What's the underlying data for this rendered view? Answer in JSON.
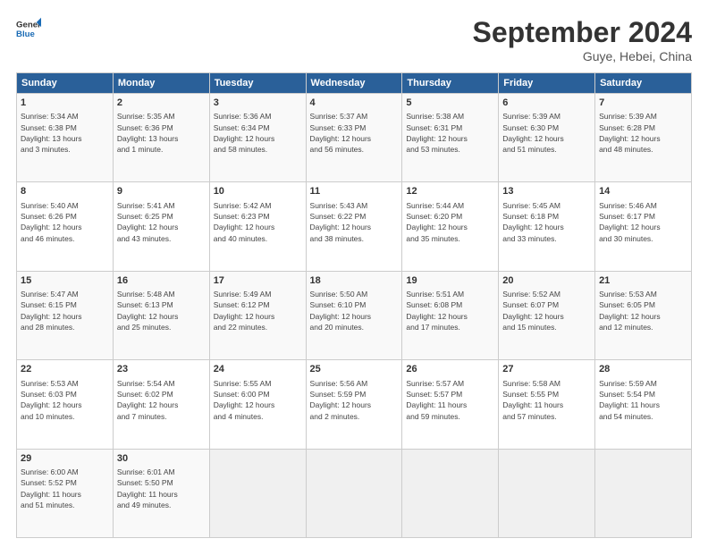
{
  "logo": {
    "line1": "General",
    "line2": "Blue"
  },
  "title": "September 2024",
  "subtitle": "Guye, Hebei, China",
  "headers": [
    "Sunday",
    "Monday",
    "Tuesday",
    "Wednesday",
    "Thursday",
    "Friday",
    "Saturday"
  ],
  "weeks": [
    [
      {
        "day": "1",
        "detail": "Sunrise: 5:34 AM\nSunset: 6:38 PM\nDaylight: 13 hours\nand 3 minutes."
      },
      {
        "day": "2",
        "detail": "Sunrise: 5:35 AM\nSunset: 6:36 PM\nDaylight: 13 hours\nand 1 minute."
      },
      {
        "day": "3",
        "detail": "Sunrise: 5:36 AM\nSunset: 6:34 PM\nDaylight: 12 hours\nand 58 minutes."
      },
      {
        "day": "4",
        "detail": "Sunrise: 5:37 AM\nSunset: 6:33 PM\nDaylight: 12 hours\nand 56 minutes."
      },
      {
        "day": "5",
        "detail": "Sunrise: 5:38 AM\nSunset: 6:31 PM\nDaylight: 12 hours\nand 53 minutes."
      },
      {
        "day": "6",
        "detail": "Sunrise: 5:39 AM\nSunset: 6:30 PM\nDaylight: 12 hours\nand 51 minutes."
      },
      {
        "day": "7",
        "detail": "Sunrise: 5:39 AM\nSunset: 6:28 PM\nDaylight: 12 hours\nand 48 minutes."
      }
    ],
    [
      {
        "day": "8",
        "detail": "Sunrise: 5:40 AM\nSunset: 6:26 PM\nDaylight: 12 hours\nand 46 minutes."
      },
      {
        "day": "9",
        "detail": "Sunrise: 5:41 AM\nSunset: 6:25 PM\nDaylight: 12 hours\nand 43 minutes."
      },
      {
        "day": "10",
        "detail": "Sunrise: 5:42 AM\nSunset: 6:23 PM\nDaylight: 12 hours\nand 40 minutes."
      },
      {
        "day": "11",
        "detail": "Sunrise: 5:43 AM\nSunset: 6:22 PM\nDaylight: 12 hours\nand 38 minutes."
      },
      {
        "day": "12",
        "detail": "Sunrise: 5:44 AM\nSunset: 6:20 PM\nDaylight: 12 hours\nand 35 minutes."
      },
      {
        "day": "13",
        "detail": "Sunrise: 5:45 AM\nSunset: 6:18 PM\nDaylight: 12 hours\nand 33 minutes."
      },
      {
        "day": "14",
        "detail": "Sunrise: 5:46 AM\nSunset: 6:17 PM\nDaylight: 12 hours\nand 30 minutes."
      }
    ],
    [
      {
        "day": "15",
        "detail": "Sunrise: 5:47 AM\nSunset: 6:15 PM\nDaylight: 12 hours\nand 28 minutes."
      },
      {
        "day": "16",
        "detail": "Sunrise: 5:48 AM\nSunset: 6:13 PM\nDaylight: 12 hours\nand 25 minutes."
      },
      {
        "day": "17",
        "detail": "Sunrise: 5:49 AM\nSunset: 6:12 PM\nDaylight: 12 hours\nand 22 minutes."
      },
      {
        "day": "18",
        "detail": "Sunrise: 5:50 AM\nSunset: 6:10 PM\nDaylight: 12 hours\nand 20 minutes."
      },
      {
        "day": "19",
        "detail": "Sunrise: 5:51 AM\nSunset: 6:08 PM\nDaylight: 12 hours\nand 17 minutes."
      },
      {
        "day": "20",
        "detail": "Sunrise: 5:52 AM\nSunset: 6:07 PM\nDaylight: 12 hours\nand 15 minutes."
      },
      {
        "day": "21",
        "detail": "Sunrise: 5:53 AM\nSunset: 6:05 PM\nDaylight: 12 hours\nand 12 minutes."
      }
    ],
    [
      {
        "day": "22",
        "detail": "Sunrise: 5:53 AM\nSunset: 6:03 PM\nDaylight: 12 hours\nand 10 minutes."
      },
      {
        "day": "23",
        "detail": "Sunrise: 5:54 AM\nSunset: 6:02 PM\nDaylight: 12 hours\nand 7 minutes."
      },
      {
        "day": "24",
        "detail": "Sunrise: 5:55 AM\nSunset: 6:00 PM\nDaylight: 12 hours\nand 4 minutes."
      },
      {
        "day": "25",
        "detail": "Sunrise: 5:56 AM\nSunset: 5:59 PM\nDaylight: 12 hours\nand 2 minutes."
      },
      {
        "day": "26",
        "detail": "Sunrise: 5:57 AM\nSunset: 5:57 PM\nDaylight: 11 hours\nand 59 minutes."
      },
      {
        "day": "27",
        "detail": "Sunrise: 5:58 AM\nSunset: 5:55 PM\nDaylight: 11 hours\nand 57 minutes."
      },
      {
        "day": "28",
        "detail": "Sunrise: 5:59 AM\nSunset: 5:54 PM\nDaylight: 11 hours\nand 54 minutes."
      }
    ],
    [
      {
        "day": "29",
        "detail": "Sunrise: 6:00 AM\nSunset: 5:52 PM\nDaylight: 11 hours\nand 51 minutes."
      },
      {
        "day": "30",
        "detail": "Sunrise: 6:01 AM\nSunset: 5:50 PM\nDaylight: 11 hours\nand 49 minutes."
      },
      {
        "day": "",
        "detail": ""
      },
      {
        "day": "",
        "detail": ""
      },
      {
        "day": "",
        "detail": ""
      },
      {
        "day": "",
        "detail": ""
      },
      {
        "day": "",
        "detail": ""
      }
    ]
  ]
}
